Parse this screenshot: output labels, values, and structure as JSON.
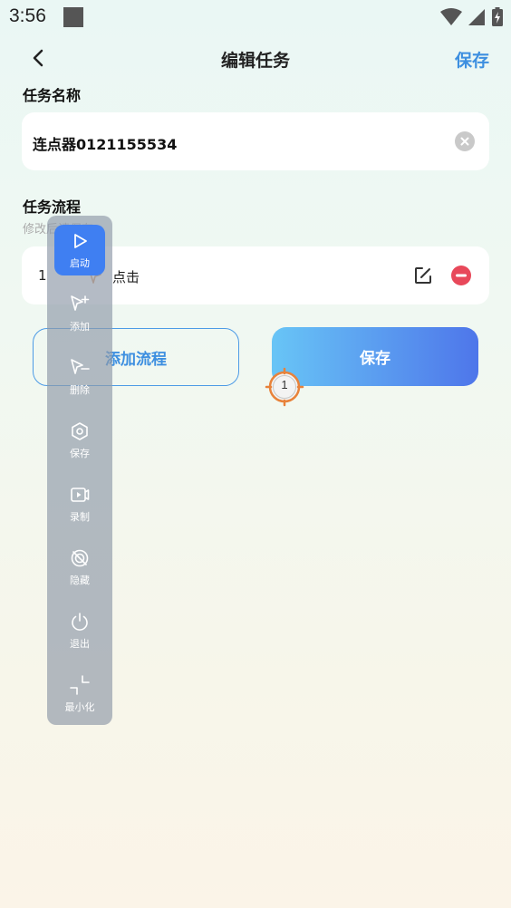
{
  "status_bar": {
    "time": "3:56"
  },
  "nav": {
    "title": "编辑任务",
    "save_label": "保存"
  },
  "task_name": {
    "label": "任务名称",
    "value": "连点器0121155534"
  },
  "task_flow": {
    "label": "任务流程",
    "hint": "修改后请保存",
    "items": [
      {
        "index": "1",
        "action": "点击"
      }
    ]
  },
  "buttons": {
    "add_flow": "添加流程",
    "save": "保存"
  },
  "target_marker": {
    "number": "1"
  },
  "floating_panel": {
    "items": [
      {
        "label": "启动",
        "icon": "play-icon",
        "active": true
      },
      {
        "label": "添加",
        "icon": "cursor-plus-icon"
      },
      {
        "label": "删除",
        "icon": "cursor-minus-icon"
      },
      {
        "label": "保存",
        "icon": "hexagon-save-icon"
      },
      {
        "label": "录制",
        "icon": "record-icon"
      },
      {
        "label": "隐藏",
        "icon": "hide-icon"
      },
      {
        "label": "退出",
        "icon": "power-icon"
      },
      {
        "label": "最小化",
        "icon": "minimize-icon"
      }
    ]
  },
  "colors": {
    "accent_blue": "#3d8fe0",
    "panel_active": "#3f7ff2",
    "remove_red": "#e8485a",
    "target_orange": "#e8823a"
  }
}
